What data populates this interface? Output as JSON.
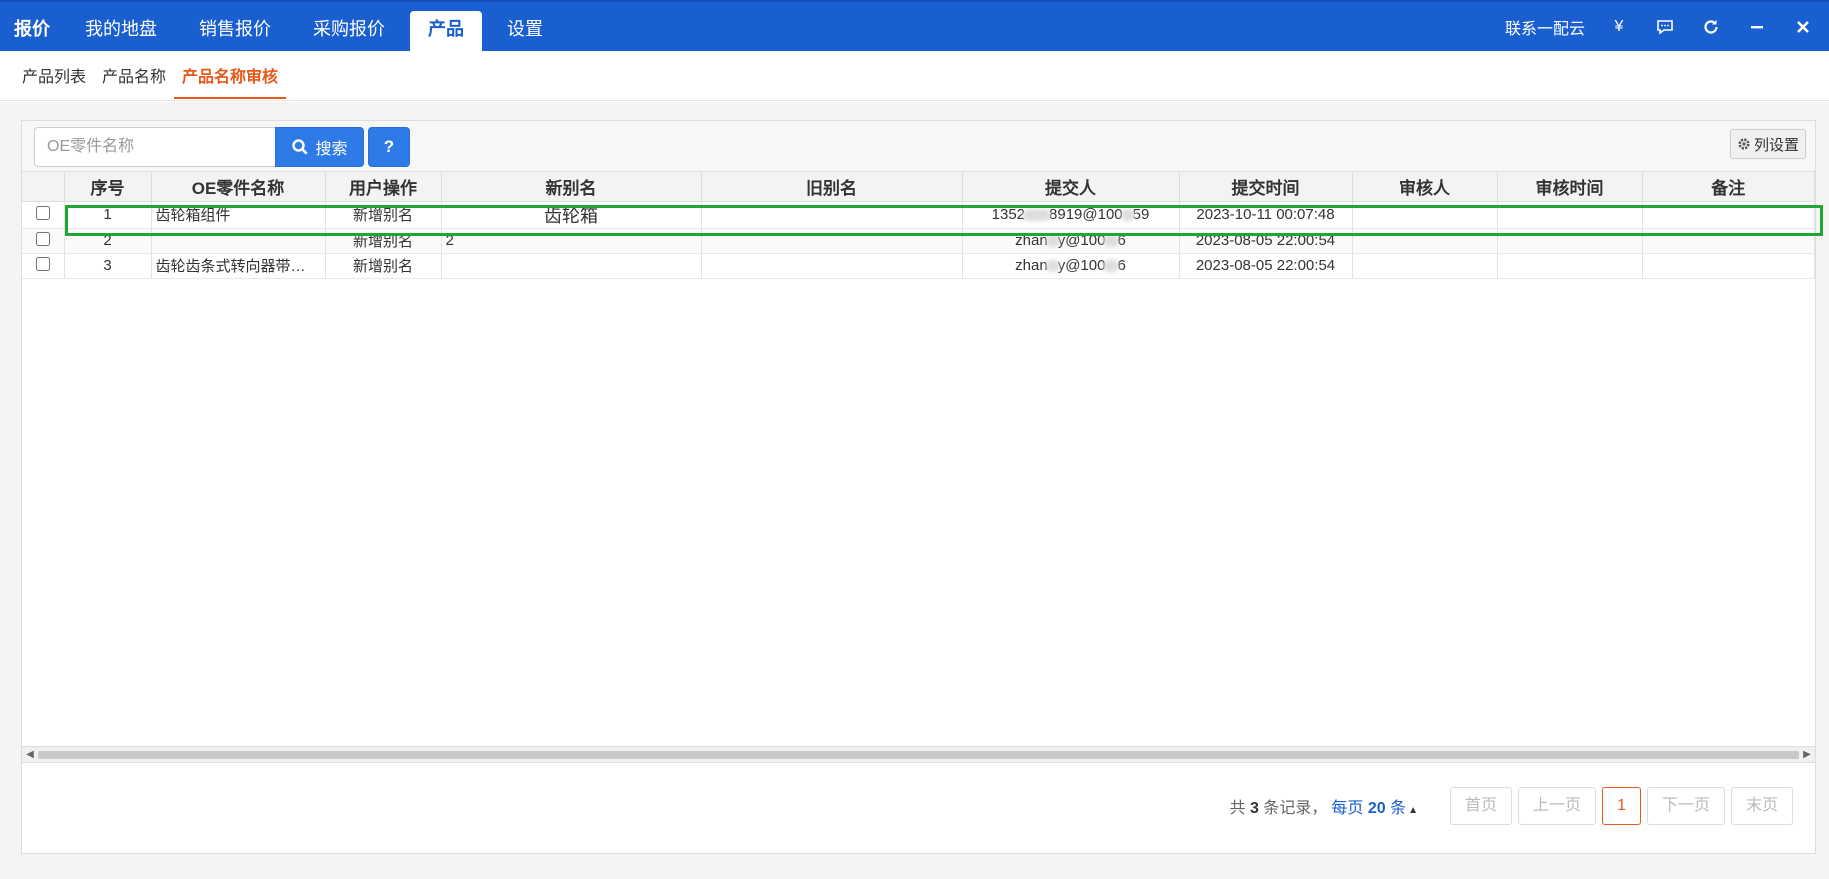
{
  "topbar": {
    "brand": "报价",
    "nav": [
      "我的地盘",
      "销售报价",
      "采购报价",
      "产品",
      "设置"
    ],
    "active_nav": "产品",
    "contact": "联系一配云",
    "currency": "¥"
  },
  "subnav": {
    "tabs": [
      "产品列表",
      "产品名称",
      "产品名称审核"
    ],
    "active_tab": "产品名称审核"
  },
  "toolbar": {
    "search_placeholder": "OE零件名称",
    "search_label": "搜索",
    "help_label": "?",
    "columns_label": "列设置"
  },
  "table": {
    "headers": [
      "序号",
      "OE零件名称",
      "用户操作",
      "新别名",
      "旧别名",
      "提交人",
      "提交时间",
      "审核人",
      "审核时间",
      "备注"
    ],
    "rows": [
      {
        "no": "1",
        "oe_name": "齿轮箱组件",
        "action": "新增别名",
        "new_alias": "齿轮箱",
        "old_alias": "",
        "submitter_a": "1352",
        "submitter_b": "8919@100",
        "submitter_c": "59",
        "time": "2023-10-11 00:07:48",
        "reviewer": "",
        "review_time": "",
        "note": ""
      },
      {
        "no": "2",
        "oe_name": "",
        "action": "新增别名",
        "new_alias": "2",
        "old_alias": "",
        "submitter_a": "zhan",
        "submitter_b": "y@100",
        "submitter_c": "6",
        "time": "2023-08-05 22:00:54",
        "reviewer": "",
        "review_time": "",
        "note": ""
      },
      {
        "no": "3",
        "oe_name": "齿轮齿条式转向器带…",
        "action": "新增别名",
        "new_alias": "",
        "old_alias": "",
        "submitter_a": "zhan",
        "submitter_b": "y@100",
        "submitter_c": "6",
        "time": "2023-08-05 22:00:54",
        "reviewer": "",
        "review_time": "",
        "note": ""
      }
    ]
  },
  "pager": {
    "total_prefix": "共",
    "total": "3",
    "total_suffix": "条记录，",
    "per_page_prefix": "每页",
    "per_page": "20",
    "per_page_suffix": "条",
    "first": "首页",
    "prev": "上一页",
    "current": "1",
    "next": "下一页",
    "last": "末页"
  },
  "colors": {
    "topbar": "#1a5fd0",
    "accent": "#e8581a",
    "button": "#2e7be8",
    "highlight": "#22a534"
  }
}
